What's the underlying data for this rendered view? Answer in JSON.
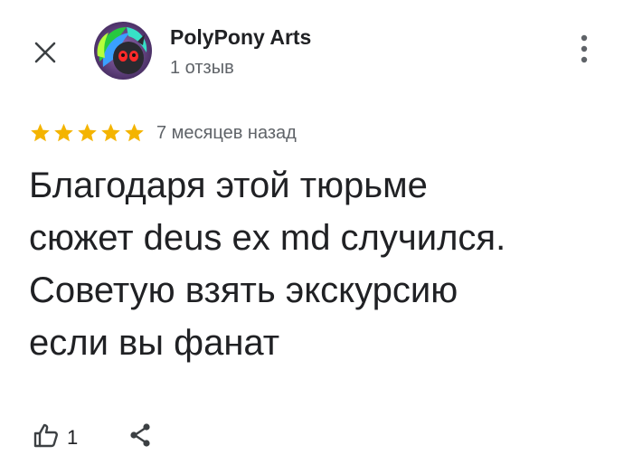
{
  "header": {
    "close_icon": "close-icon",
    "author_name": "PolyPony Arts",
    "review_count": "1 отзыв",
    "more_icon": "more-vert-icon"
  },
  "review": {
    "rating": 5,
    "max_rating": 5,
    "date": "7 месяцев назад",
    "text_lines": [
      "Благодаря этой тюрьме",
      "сюжет deus ex md случился.",
      "Советую взять экскурсию",
      "если вы фанат"
    ]
  },
  "actions": {
    "like_icon": "thumb-up-icon",
    "like_count": "1",
    "share_icon": "share-icon"
  },
  "colors": {
    "star": "#F4B400",
    "text": "#202124",
    "muted": "#5f6368"
  }
}
